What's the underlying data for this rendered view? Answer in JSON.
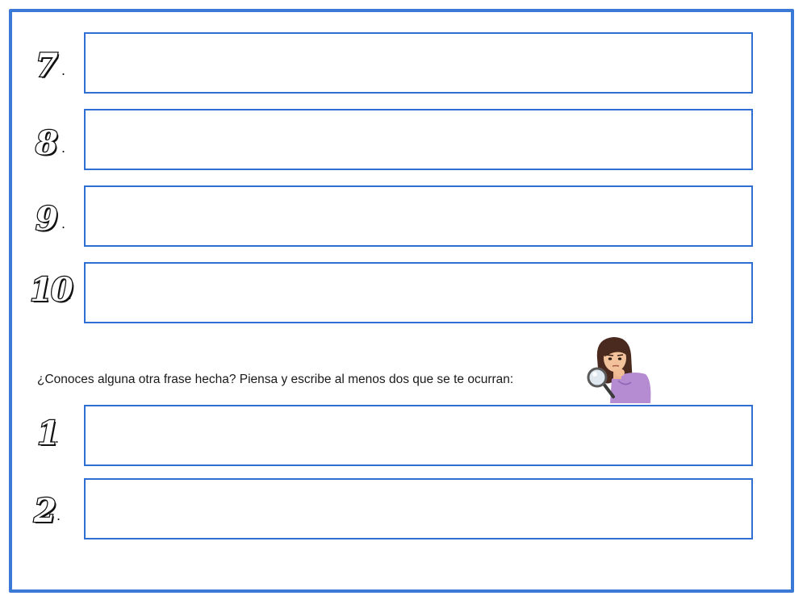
{
  "items": [
    {
      "number": "7",
      "dot": "."
    },
    {
      "number": "8",
      "dot": "."
    },
    {
      "number": "9",
      "dot": "."
    },
    {
      "number": "10",
      "dot": "."
    }
  ],
  "prompt": {
    "text": "¿Conoces alguna otra frase hecha? Piensa y escribe al menos dos que se te ocurran:"
  },
  "extra_items": [
    {
      "number": "1",
      "dot": "."
    },
    {
      "number": "2",
      "dot": "."
    }
  ],
  "colors": {
    "frame": "#3b79d6",
    "box_border": "#2f6fd3"
  },
  "icons": {
    "avatar": "girl-with-magnifying-glass-avatar"
  }
}
